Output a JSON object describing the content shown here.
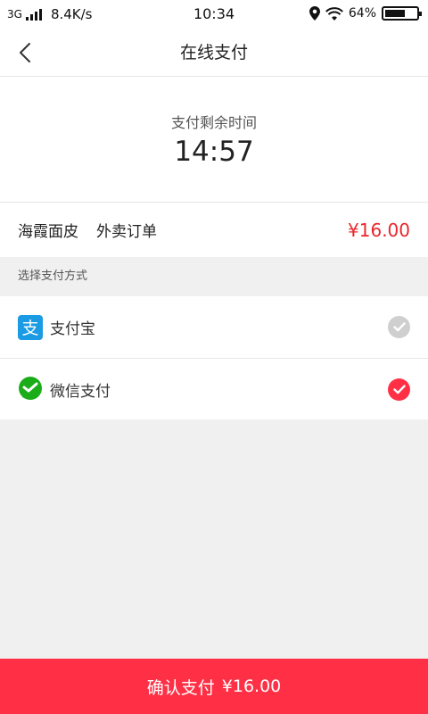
{
  "status_bar": {
    "network": "3G",
    "speed": "8.4K/s",
    "time": "10:34",
    "battery": "64%",
    "battery_level": 0.64,
    "icons": [
      "signal-icon",
      "location-icon",
      "wifi-icon",
      "battery-icon"
    ]
  },
  "nav": {
    "title": "在线支付",
    "back_icon": "chevron-left-icon"
  },
  "timer": {
    "label": "支付剩余时间",
    "value": "14:57"
  },
  "order": {
    "shop": "海霞面皮",
    "type": "外卖订单",
    "price": "¥16.00"
  },
  "payment": {
    "section_title": "选择支付方式",
    "methods": [
      {
        "label": "支付宝",
        "icon": "alipay-icon",
        "selected": false
      },
      {
        "label": "微信支付",
        "icon": "wechat-pay-icon",
        "selected": true
      }
    ]
  },
  "confirm": {
    "label": "确认支付",
    "amount": "¥16.00"
  },
  "colors": {
    "accent": "#ff3045",
    "price": "#e8262c",
    "alipay": "#1a9be4",
    "wechat": "#1aad19",
    "unchecked": "#cfcfcf"
  }
}
